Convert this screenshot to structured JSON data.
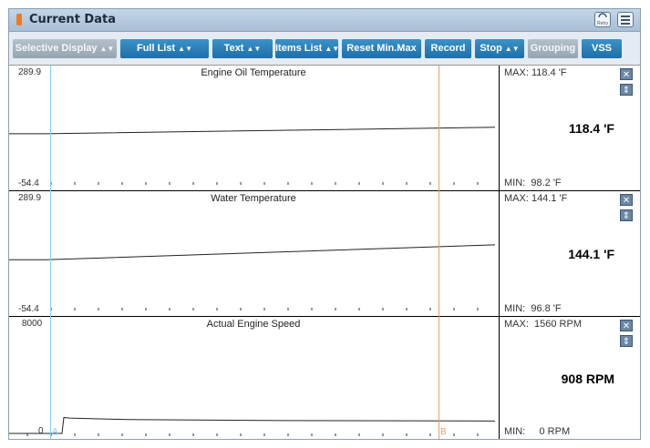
{
  "window": {
    "title": "Current Data",
    "retry_icon": "retry-icon",
    "menu_icon": "menu-icon"
  },
  "toolbar": {
    "selective_display": "Selective Display",
    "full_list": "Full List",
    "text": "Text",
    "items_list": "Items List",
    "reset_min_max": "Reset Min.Max",
    "record": "Record",
    "stop": "Stop",
    "grouping": "Grouping",
    "vss": "VSS"
  },
  "graphs": [
    {
      "title": "Engine Oil Temperature",
      "ymax": "289.9",
      "ymin": "-54.4",
      "max": "MAX: 118.4 'F",
      "min": "MIN:  98.2 'F",
      "current": "118.4 'F",
      "start": 98.2,
      "end": 118.4,
      "range": [
        -54.4,
        289.9
      ]
    },
    {
      "title": "Water Temperature",
      "ymax": "289.9",
      "ymin": "-54.4",
      "max": "MAX: 144.1 'F",
      "min": "MIN:  96.8 'F",
      "current": "144.1 'F",
      "start": 96.8,
      "end": 144.1,
      "range": [
        -54.4,
        289.9
      ]
    },
    {
      "title": "Actual Engine Speed",
      "ymax": "8000",
      "ymin": "0",
      "max": "MAX:  1560 RPM",
      "min": "MIN:     0 RPM",
      "current": "908 RPM",
      "start": 0,
      "end": 908,
      "peak": 1560,
      "range": [
        0,
        8000
      ]
    }
  ],
  "cursors": {
    "a": "A",
    "b": "B"
  },
  "colors": {
    "accent": "#1f6ea8",
    "cursor_a": "#8ad0f0",
    "cursor_b": "#e0a070"
  }
}
